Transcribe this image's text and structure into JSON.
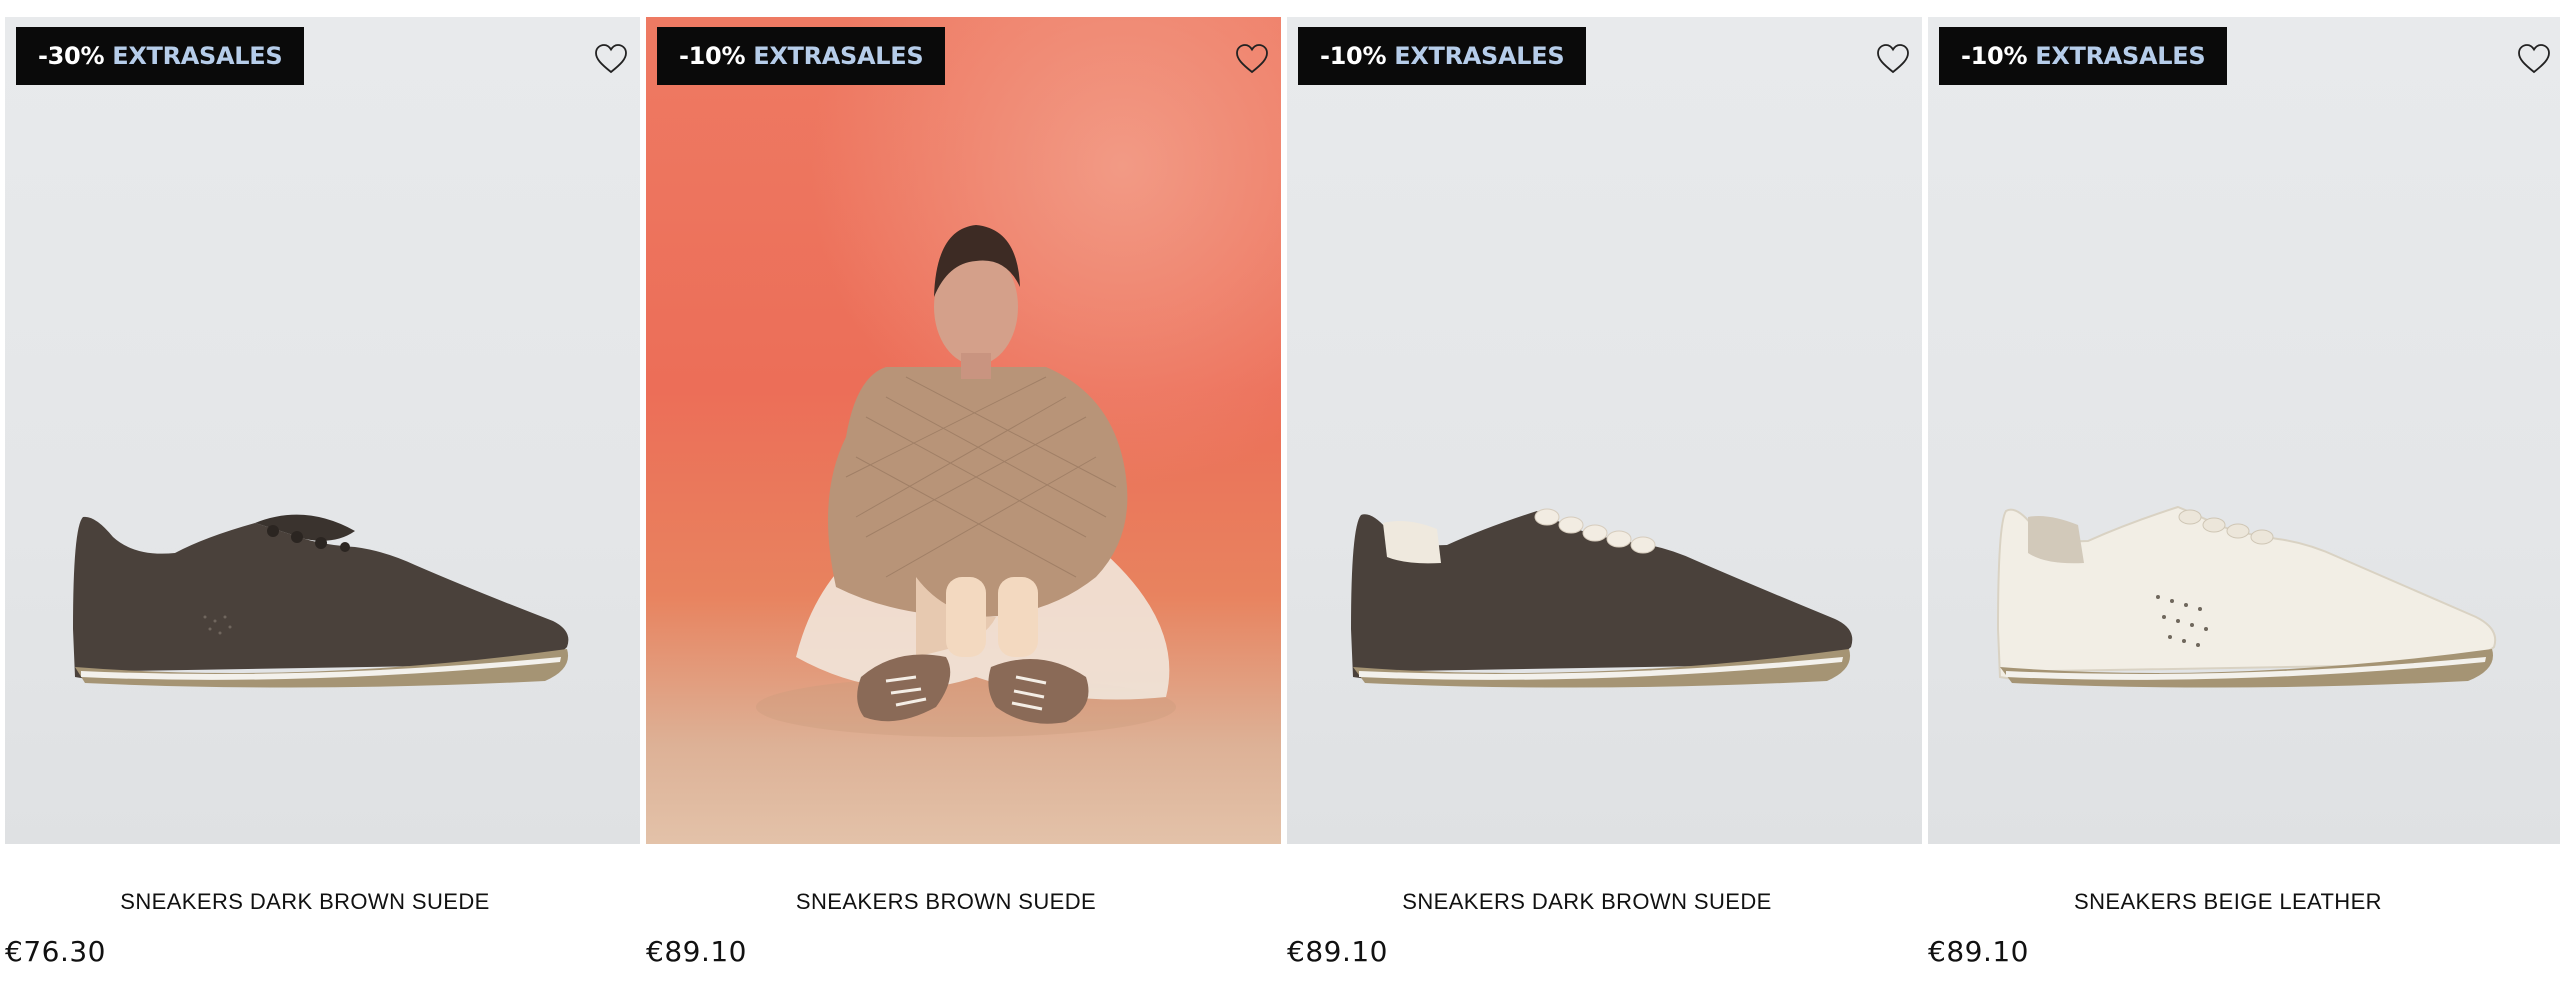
{
  "products": [
    {
      "discount": "-30%",
      "label": "EXTRASALES",
      "name": "SNEAKERS DARK BROWN SUEDE",
      "price": "€76.30",
      "image": "dark-brown-sneaker"
    },
    {
      "discount": "-10%",
      "label": "EXTRASALES",
      "name": "SNEAKERS BROWN SUEDE",
      "price": "€89.10",
      "image": "model-wearing-brown-sneakers"
    },
    {
      "discount": "-10%",
      "label": "EXTRASALES",
      "name": "SNEAKERS DARK BROWN SUEDE",
      "price": "€89.10",
      "image": "dark-brown-sneaker-cream-laces"
    },
    {
      "discount": "-10%",
      "label": "EXTRASALES",
      "name": "SNEAKERS BEIGE LEATHER",
      "price": "€89.10",
      "image": "beige-leather-sneaker"
    }
  ],
  "colors": {
    "badge_bg": "#0a0a0a",
    "badge_label": "#b6cdea",
    "photo_bg": "#e6e8ea",
    "red_bg": "#ec6e58"
  },
  "icons": {
    "wishlist": "heart-outline-icon"
  }
}
